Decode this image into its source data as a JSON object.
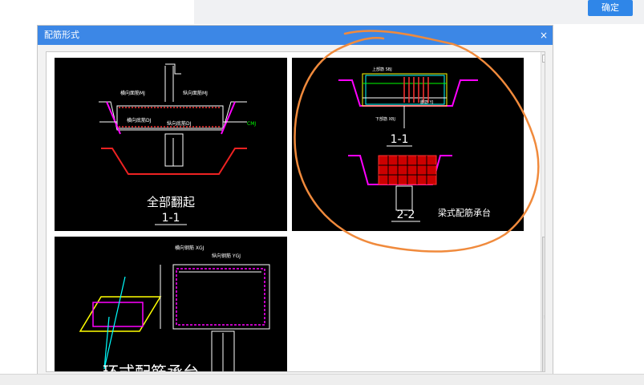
{
  "toolbar": {
    "confirm_label": "确定"
  },
  "dialog": {
    "title": "配筋形式",
    "close_glyph": "×"
  },
  "thumbnails": [
    {
      "caption": "全部翻起",
      "section": "1-1",
      "labels": [
        "横向面筋MJ",
        "纵向面筋MJ",
        "横向底筋DJ",
        "纵向底筋DJ",
        "CMJ"
      ]
    },
    {
      "caption": "梁式配筋承台",
      "section_top": "1-1",
      "section_bottom": "2-2",
      "labels": [
        "上部筋 SBJ",
        "下部筋 XBJ",
        "腰筋 YJ"
      ]
    },
    {
      "caption": "环式配筋承台",
      "section": "",
      "labels": [
        "横向钢筋 XGJ",
        "纵向钢筋 YGJ"
      ]
    }
  ],
  "scrollbar": {
    "up_glyph": "▲",
    "grip_glyph": "≡"
  },
  "colors": {
    "title_bar": "#3c87e6",
    "annotation": "#f08a3c",
    "drawing_bg": "#000000"
  }
}
